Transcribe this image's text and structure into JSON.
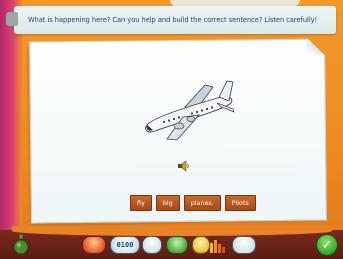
{
  "instruction": {
    "text": "What is happening here? Can you help and build the correct sentence? Listen carefully!"
  },
  "words": [
    "fly",
    "big",
    "planes.",
    "Pilots"
  ],
  "toolbar": {
    "counter": "0100",
    "check_label": "✓"
  },
  "colors": {
    "background": "#f19a2c",
    "word_tile": "#b6561f",
    "instruction_text": "#1e3f74",
    "toolbar": "#6b231a",
    "check": "#38a52a"
  },
  "icons": [
    "pin-icon",
    "airplane-icon",
    "speaker-icon",
    "potion-icon",
    "arrow-icon",
    "clock-icon",
    "home-icon",
    "book-icon",
    "bars-icon",
    "window-icon",
    "check-icon"
  ]
}
